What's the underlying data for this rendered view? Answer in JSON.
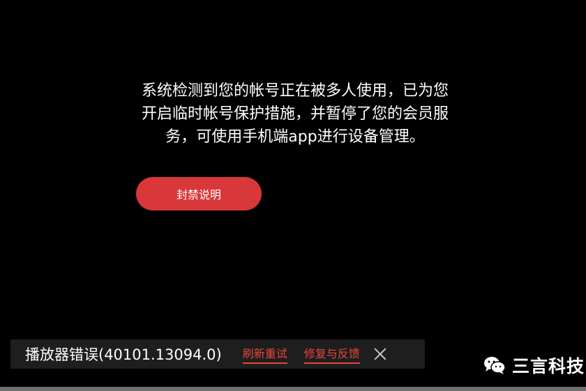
{
  "notice": {
    "lines": [
      "系统检测到您的帐号正在被多人使用，已为您",
      "开启临时帐号保护措施，并暂停了您的会员服",
      "务，可使用手机端app进行设备管理。"
    ]
  },
  "ban_button": {
    "label": "封禁说明"
  },
  "error_bar": {
    "message": "播放器错误(40101.13094.0)",
    "refresh_label": "刷新重试",
    "feedback_label": "修复与反馈",
    "close_icon": "close-icon"
  },
  "watermark": {
    "icon": "wechat-icon",
    "text": "三言科技"
  },
  "colors": {
    "background": "#000000",
    "button": "#d8383a",
    "link": "#e8463c",
    "error_bar": "#1e1e1e"
  }
}
